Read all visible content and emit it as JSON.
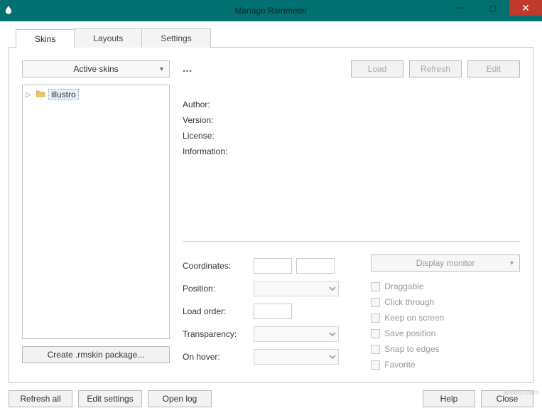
{
  "window": {
    "title": "Manage Rainmeter"
  },
  "tabs": {
    "skins": "Skins",
    "layouts": "Layouts",
    "settings": "Settings"
  },
  "left": {
    "active_skins": "Active skins",
    "tree_item": "illustro",
    "create_package": "Create .rmskin package..."
  },
  "right": {
    "name_placeholder": "...",
    "load": "Load",
    "refresh": "Refresh",
    "edit": "Edit",
    "meta": {
      "author": "Author:",
      "version": "Version:",
      "license": "License:",
      "information": "Information:"
    },
    "labels": {
      "coordinates": "Coordinates:",
      "position": "Position:",
      "load_order": "Load order:",
      "transparency": "Transparency:",
      "on_hover": "On hover:",
      "display_monitor": "Display monitor"
    },
    "checks": {
      "draggable": "Draggable",
      "click_through": "Click through",
      "keep_on_screen": "Keep on screen",
      "save_position": "Save position",
      "snap_to_edges": "Snap to edges",
      "favorite": "Favorite"
    }
  },
  "footer": {
    "refresh_all": "Refresh all",
    "edit_settings": "Edit settings",
    "open_log": "Open log",
    "help": "Help",
    "close": "Close"
  },
  "watermark": "wsxdn.com"
}
